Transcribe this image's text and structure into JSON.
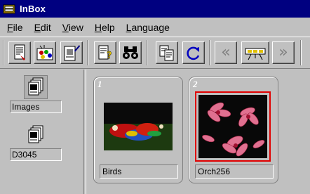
{
  "window": {
    "title": "InBox"
  },
  "menu": {
    "items": [
      {
        "label": "File",
        "underline": "F"
      },
      {
        "label": "Edit",
        "underline": "E"
      },
      {
        "label": "View",
        "underline": "V"
      },
      {
        "label": "Help",
        "underline": "H"
      },
      {
        "label": "Language",
        "underline": "L"
      }
    ]
  },
  "toolbar": {
    "buttons": [
      "new-document-icon",
      "image-collage-icon",
      "edit-document-icon",
      "document-help-icon",
      "binoculars-icon",
      "copy-icon",
      "refresh-icon",
      "previous-icon",
      "slideshow-icon",
      "next-icon"
    ],
    "prev_glyph": "«",
    "next_glyph": "»"
  },
  "folders": [
    {
      "label": "Images",
      "selected": true
    },
    {
      "label": "D3045",
      "selected": false
    }
  ],
  "items": [
    {
      "number": "1",
      "caption": "Birds",
      "selected": false,
      "thumbnail": "parrots"
    },
    {
      "number": "2",
      "caption": "Orch256",
      "selected": true,
      "thumbnail": "orchids"
    }
  ],
  "colors": {
    "title_bar": "#000080",
    "selection": "#e00000",
    "background": "#c0c0c0"
  }
}
